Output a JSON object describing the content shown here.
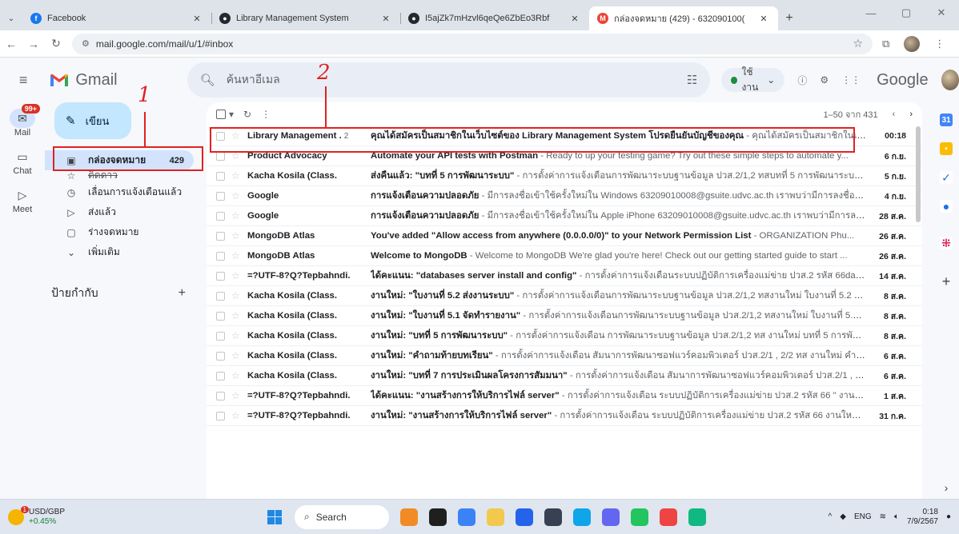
{
  "browser": {
    "tabs": [
      {
        "label": "Facebook",
        "icon": "facebook-icon",
        "color": "#1877f2",
        "active": false
      },
      {
        "label": "Library Management System",
        "icon": "github-icon",
        "color": "#24292f",
        "active": false
      },
      {
        "label": "I5ajZk7mHzvl6qeQe6ZbEo3Rbf",
        "icon": "github-icon",
        "color": "#24292f",
        "active": false
      },
      {
        "label": "กล่องจดหมาย (429) - 632090100(",
        "icon": "gmail-icon",
        "color": "#ea4335",
        "active": true
      }
    ],
    "url": "mail.google.com/mail/u/1/#inbox"
  },
  "gmail": {
    "app_name": "Gmail",
    "search_placeholder": "ค้นหาอีเมล",
    "status_label": "ใช้งาน",
    "brand": "Google",
    "compose_label": "เขียน",
    "rail": [
      {
        "label": "Mail",
        "icon": "mail-icon",
        "badge": "99+",
        "active": true
      },
      {
        "label": "Chat",
        "icon": "chat-icon",
        "badge": "",
        "active": false
      },
      {
        "label": "Meet",
        "icon": "video-icon",
        "badge": "",
        "active": false
      }
    ],
    "nav": [
      {
        "label": "กล่องจดหมาย",
        "count": "429",
        "icon": "inbox-icon",
        "glyph": "▣",
        "active": true,
        "strike": false
      },
      {
        "label": "ติดดาว",
        "count": "",
        "icon": "star-icon",
        "glyph": "☆",
        "active": false,
        "strike": true
      },
      {
        "label": "เลื่อนการแจ้งเตือนแล้ว",
        "count": "",
        "icon": "clock-icon",
        "glyph": "◷",
        "active": false,
        "strike": false
      },
      {
        "label": "ส่งแล้ว",
        "count": "",
        "icon": "send-icon",
        "glyph": "▷",
        "active": false,
        "strike": false
      },
      {
        "label": "ร่างจดหมาย",
        "count": "",
        "icon": "draft-icon",
        "glyph": "▢",
        "active": false,
        "strike": false
      },
      {
        "label": "เพิ่มเติม",
        "count": "",
        "icon": "chevron-down-icon",
        "glyph": "⌄",
        "active": false,
        "strike": false
      }
    ],
    "labels_heading": "ป้ายกำกับ",
    "pagination": "1–50 จาก 431",
    "emails": [
      {
        "sender": "Library Management .",
        "thread_count": "2",
        "subject": "คุณได้สมัครเป็นสมาชิกในเว็บไซต์ของ Library Management System โปรดยืนยันบัญชีของคุณ",
        "preview": " - คุณได้สมัครเป็นสมาชิกในเว็บไซต์...",
        "date": "00:18"
      },
      {
        "sender": "Product Advocacy",
        "thread_count": "",
        "subject": "Automate your API tests with Postman",
        "preview": " - Ready to up your testing game? Try out these simple steps to automate y...",
        "date": "6 ก.ย."
      },
      {
        "sender": "Kacha Kosila (Class.",
        "thread_count": "",
        "subject": "ส่งคืนแล้ว: \"บทที่ 5 การพัฒนาระบบ\"",
        "preview": " - การตั้งค่าการแจ้งเตือนการพัฒนาระบบฐานข้อมูล ปวส.2/1,2 ทสบทที่ 5 การพัฒนาระบบส่งคืนแล้...",
        "date": "5 ก.ย."
      },
      {
        "sender": "Google",
        "thread_count": "",
        "subject": "การแจ้งเตือนความปลอดภัย",
        "preview": " - มีการลงชื่อเข้าใช้ครั้งใหม่ใน Windows 63209010008@gsuite.udvc.ac.th เราพบว่ามีการลงชื่อเข้าใช้บั...",
        "date": "4 ก.ย."
      },
      {
        "sender": "Google",
        "thread_count": "",
        "subject": "การแจ้งเตือนความปลอดภัย",
        "preview": " - มีการลงชื่อเข้าใช้ครั้งใหม่ใน Apple iPhone 63209010008@gsuite.udvc.ac.th เราพบว่ามีการลงชื่อเข้...",
        "date": "28 ส.ค."
      },
      {
        "sender": "MongoDB Atlas",
        "thread_count": "",
        "subject": "You've added \"Allow access from anywhere (0.0.0.0/0)\" to your Network Permission List",
        "preview": " - ORGANIZATION Phu...",
        "date": "26 ส.ค."
      },
      {
        "sender": "MongoDB Atlas",
        "thread_count": "",
        "subject": "Welcome to MongoDB",
        "preview": " - Welcome to MongoDB We're glad you're here! Check out our getting started guide to start ...",
        "date": "26 ส.ค."
      },
      {
        "sender": "=?UTF-8?Q?Tepbahndi.",
        "thread_count": "",
        "subject": "ได้คะแนน: \"databases server install and config\"",
        "preview": " - การตั้งค่าการแจ้งเตือนระบบปฏิบัติการเครื่องแม่ข่าย ปวส.2 รหัส 66databa...",
        "date": "14 ส.ค."
      },
      {
        "sender": "Kacha Kosila (Class.",
        "thread_count": "",
        "subject": "งานใหม่: \"ใบงานที่ 5.2 ส่งงานระบบ\"",
        "preview": " - การตั้งค่าการแจ้งเตือนการพัฒนาระบบฐานข้อมูล ปวส.2/1,2 ทสงานใหม่ ใบงานที่ 5.2 ส่งงานระบ...",
        "date": "8 ส.ค."
      },
      {
        "sender": "Kacha Kosila (Class.",
        "thread_count": "",
        "subject": "งานใหม่: \"ใบงานที่ 5.1 จัดทำรายงาน\"",
        "preview": " - การตั้งค่าการแจ้งเตือนการพัฒนาระบบฐานข้อมูล ปวส.2/1,2 ทสงานใหม่ ใบงานที่ 5.1 จัดทำรายง...",
        "date": "8 ส.ค."
      },
      {
        "sender": "Kacha Kosila (Class.",
        "thread_count": "",
        "subject": "งานใหม่: \"บทที่ 5 การพัฒนาระบบ\"",
        "preview": " - การตั้งค่าการแจ้งเตือน การพัฒนาระบบฐานข้อมูล ปวส.2/1,2 ทส งานใหม่ บทที่ 5 การพัฒนาระบบ ...",
        "date": "8 ส.ค."
      },
      {
        "sender": "Kacha Kosila (Class.",
        "thread_count": "",
        "subject": "งานใหม่: \"คำถามท้ายบทเรียน\"",
        "preview": " - การตั้งค่าการแจ้งเตือน สัมนาการพัฒนาซอฟแวร์คอมพิวเตอร์ ปวส.2/1 , 2/2 ทส งานใหม่ คำถามท้ายบท...",
        "date": "6 ส.ค."
      },
      {
        "sender": "Kacha Kosila (Class.",
        "thread_count": "",
        "subject": "งานใหม่: \"บทที่ 7 การประเมินผลโครงการสัมมนา\"",
        "preview": " - การตั้งค่าการแจ้งเตือน สัมนาการพัฒนาซอฟแวร์คอมพิวเตอร์ ปวส.2/1 , 2/2 ทส งา...",
        "date": "6 ส.ค."
      },
      {
        "sender": "=?UTF-8?Q?Tepbahndi.",
        "thread_count": "",
        "subject": "ได้คะแนน: \"งานสร้างการให้บริการไฟล์ server\"",
        "preview": " - การตั้งค่าการแจ้งเตือน ระบบปฏิบัติการเครื่องแม่ข่าย ปวส.2 รหัส 66 \" งานสร้างการใ...",
        "date": "1 ส.ค."
      },
      {
        "sender": "=?UTF-8?Q?Tepbahndi.",
        "thread_count": "",
        "subject": "งานใหม่: \"งานสร้างการให้บริการไฟล์ server\"",
        "preview": " - การตั้งค่าการแจ้งเตือน ระบบปฏิบัติการเครื่องแม่ข่าย ปวส.2 รหัส 66 งานใหม่ งานสร้าง...",
        "date": "31 ก.ค."
      }
    ]
  },
  "annotations": [
    {
      "number": "1",
      "color": "#e02222"
    },
    {
      "number": "2",
      "color": "#e02222"
    }
  ],
  "taskbar": {
    "ticker": "USD/GBP",
    "ticker_change": "+0.45%",
    "search_label": "Search",
    "lang": "ENG",
    "time": "0:18",
    "date": "7/9/2567"
  }
}
